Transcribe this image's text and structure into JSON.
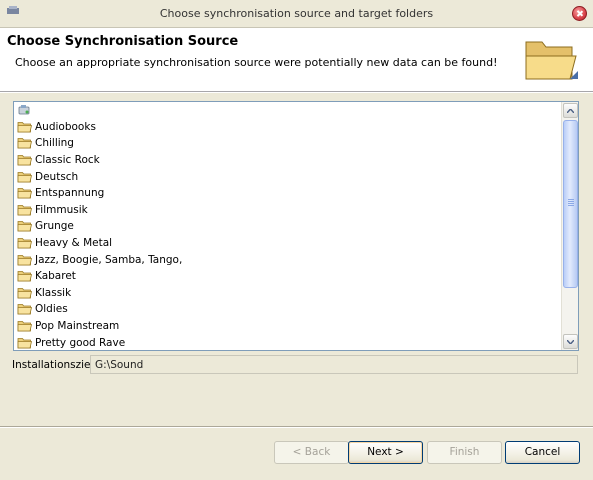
{
  "window": {
    "title": "Choose synchronisation source and target folders"
  },
  "header": {
    "title": "Choose Synchronisation Source",
    "description": "Choose an appropriate synchronisation source were potentially new data can be found!"
  },
  "tree": {
    "items": [
      {
        "label": "",
        "icon": "drive-icon"
      },
      {
        "label": "Audiobooks",
        "icon": "folder-icon"
      },
      {
        "label": "Chilling",
        "icon": "folder-icon"
      },
      {
        "label": "Classic Rock",
        "icon": "folder-icon"
      },
      {
        "label": "Deutsch",
        "icon": "folder-icon"
      },
      {
        "label": "Entspannung",
        "icon": "folder-icon"
      },
      {
        "label": "Filmmusik",
        "icon": "folder-icon"
      },
      {
        "label": "Grunge",
        "icon": "folder-icon"
      },
      {
        "label": "Heavy & Metal",
        "icon": "folder-icon"
      },
      {
        "label": "Jazz, Boogie, Samba, Tango,",
        "icon": "folder-icon"
      },
      {
        "label": "Kabaret",
        "icon": "folder-icon"
      },
      {
        "label": "Klassik",
        "icon": "folder-icon"
      },
      {
        "label": "Oldies",
        "icon": "folder-icon"
      },
      {
        "label": "Pop Mainstream",
        "icon": "folder-icon"
      },
      {
        "label": "Pretty good Rave",
        "icon": "folder-icon"
      }
    ]
  },
  "install": {
    "label": "Installationsziel:",
    "value": "G:\\Sound"
  },
  "buttons": {
    "back": "< Back",
    "next": "Next >",
    "finish": "Finish",
    "cancel": "Cancel"
  },
  "colors": {
    "window_bg": "#ece9d8",
    "scroll_thumb": "#b9cdf7",
    "close_button": "#d9434a"
  }
}
